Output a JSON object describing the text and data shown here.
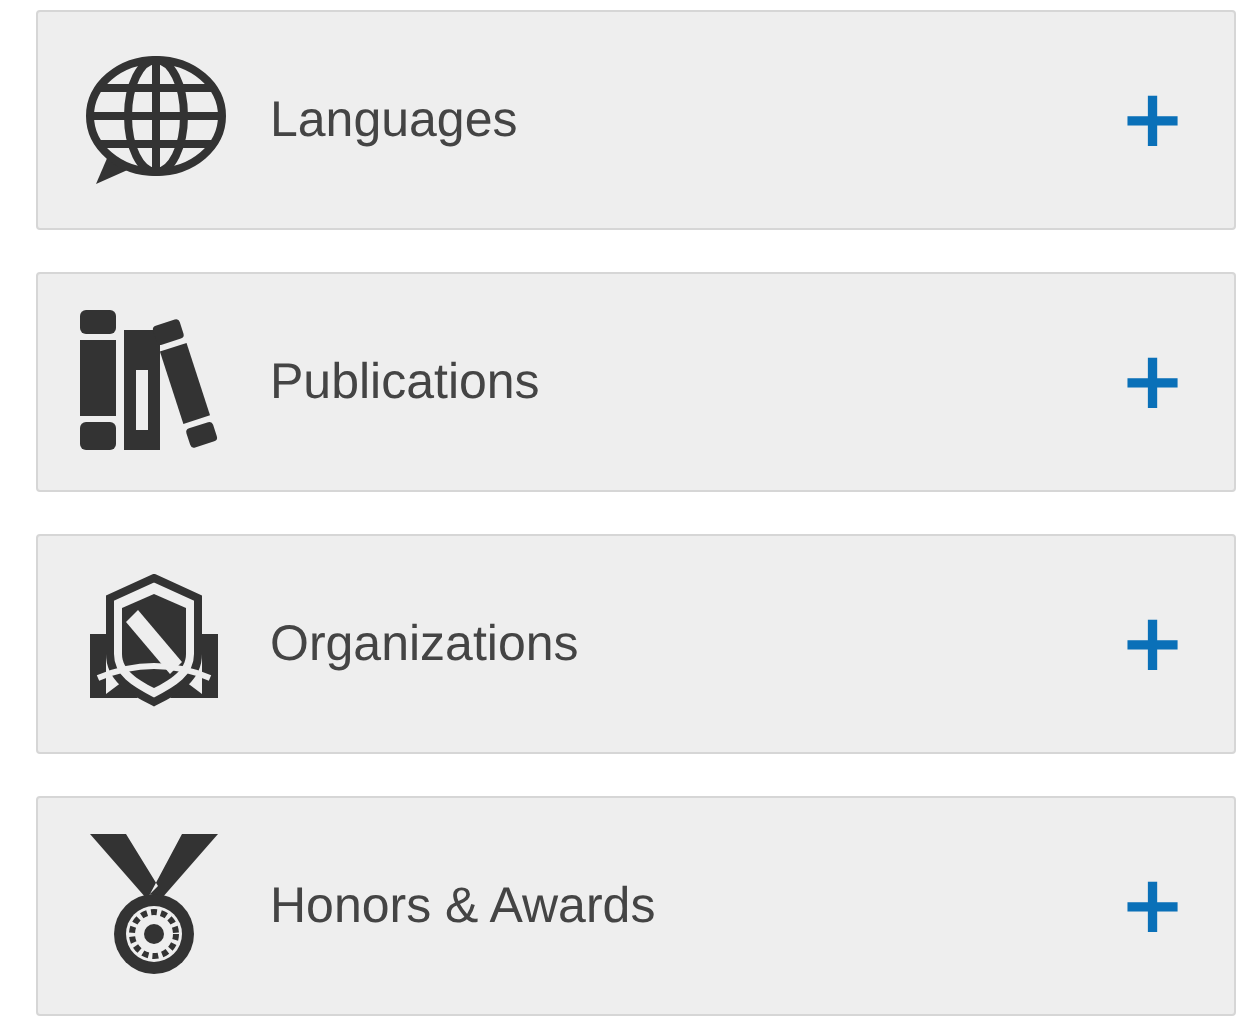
{
  "sections": [
    {
      "kind": "globe",
      "label": "Languages",
      "action": "+"
    },
    {
      "kind": "books",
      "label": "Publications",
      "action": "+"
    },
    {
      "kind": "shield",
      "label": "Organizations",
      "action": "+"
    },
    {
      "kind": "medal",
      "label": "Honors & Awards",
      "action": "+"
    }
  ]
}
